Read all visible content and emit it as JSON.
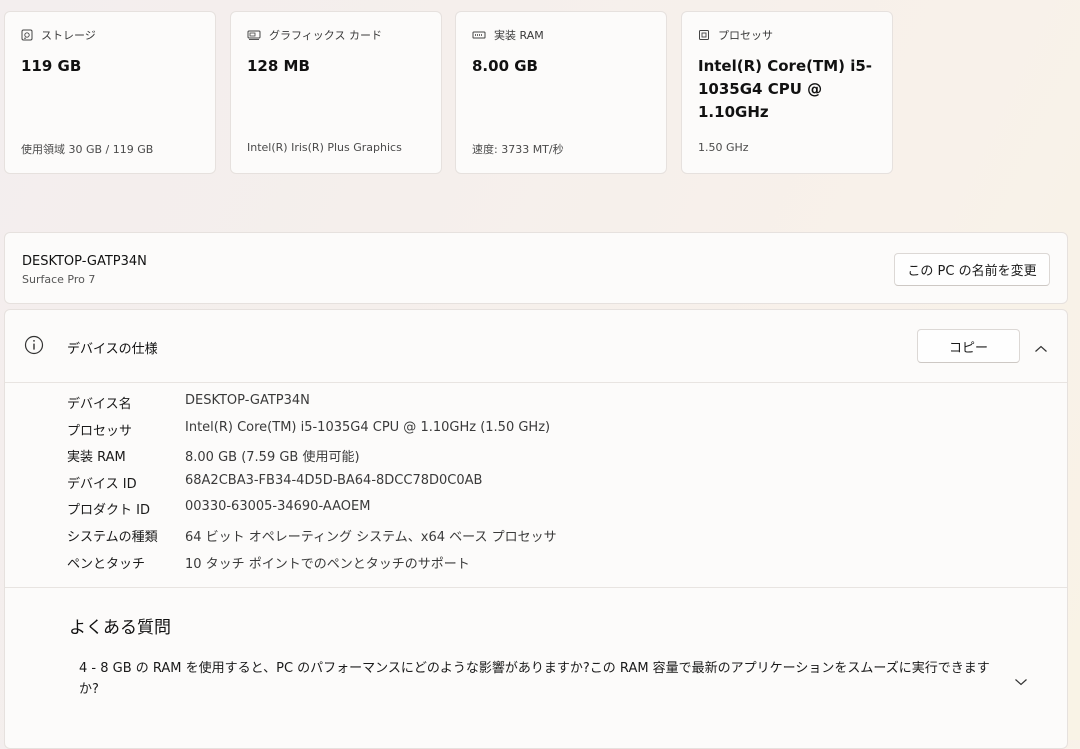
{
  "spec_cards": [
    {
      "icon": "storage-icon",
      "title": "ストレージ",
      "value": "119 GB",
      "sub": "使用領域 30 GB / 119 GB"
    },
    {
      "icon": "graphics-card-icon",
      "title": "グラフィックス カード",
      "value": "128 MB",
      "sub": "Intel(R) Iris(R) Plus Graphics"
    },
    {
      "icon": "ram-icon",
      "title": "実装 RAM",
      "value": "8.00 GB",
      "sub": "速度: 3733 MT/秒"
    },
    {
      "icon": "processor-icon",
      "title": "プロセッサ",
      "value": "Intel(R) Core(TM) i5-1035G4 CPU @ 1.10GHz",
      "sub": "1.50 GHz"
    }
  ],
  "pc": {
    "name": "DESKTOP-GATP34N",
    "model": "Surface Pro 7",
    "rename_label": "この PC の名前を変更"
  },
  "device_specs": {
    "icon": "info-icon",
    "title": "デバイスの仕様",
    "copy_label": "コピー",
    "rows": [
      {
        "label": "デバイス名",
        "value": "DESKTOP-GATP34N"
      },
      {
        "label": "プロセッサ",
        "value": "Intel(R) Core(TM) i5-1035G4 CPU @ 1.10GHz (1.50 GHz)"
      },
      {
        "label": "実装 RAM",
        "value": "8.00 GB (7.59 GB 使用可能)"
      },
      {
        "label": "デバイス ID",
        "value": "68A2CBA3-FB34-4D5D-BA64-8DCC78D0C0AB"
      },
      {
        "label": "プロダクト ID",
        "value": "00330-63005-34690-AAOEM"
      },
      {
        "label": "システムの種類",
        "value": "64 ビット オペレーティング システム、x64 ベース プロセッサ"
      },
      {
        "label": "ペンとタッチ",
        "value": "10 タッチ ポイントでのペンとタッチのサポート"
      }
    ]
  },
  "faq": {
    "title": "よくある質問",
    "question": "4 - 8 GB の RAM を使用すると、PC のパフォーマンスにどのような影響がありますか?この RAM 容量で最新のアプリケーションをスムーズに実行できますか?"
  }
}
